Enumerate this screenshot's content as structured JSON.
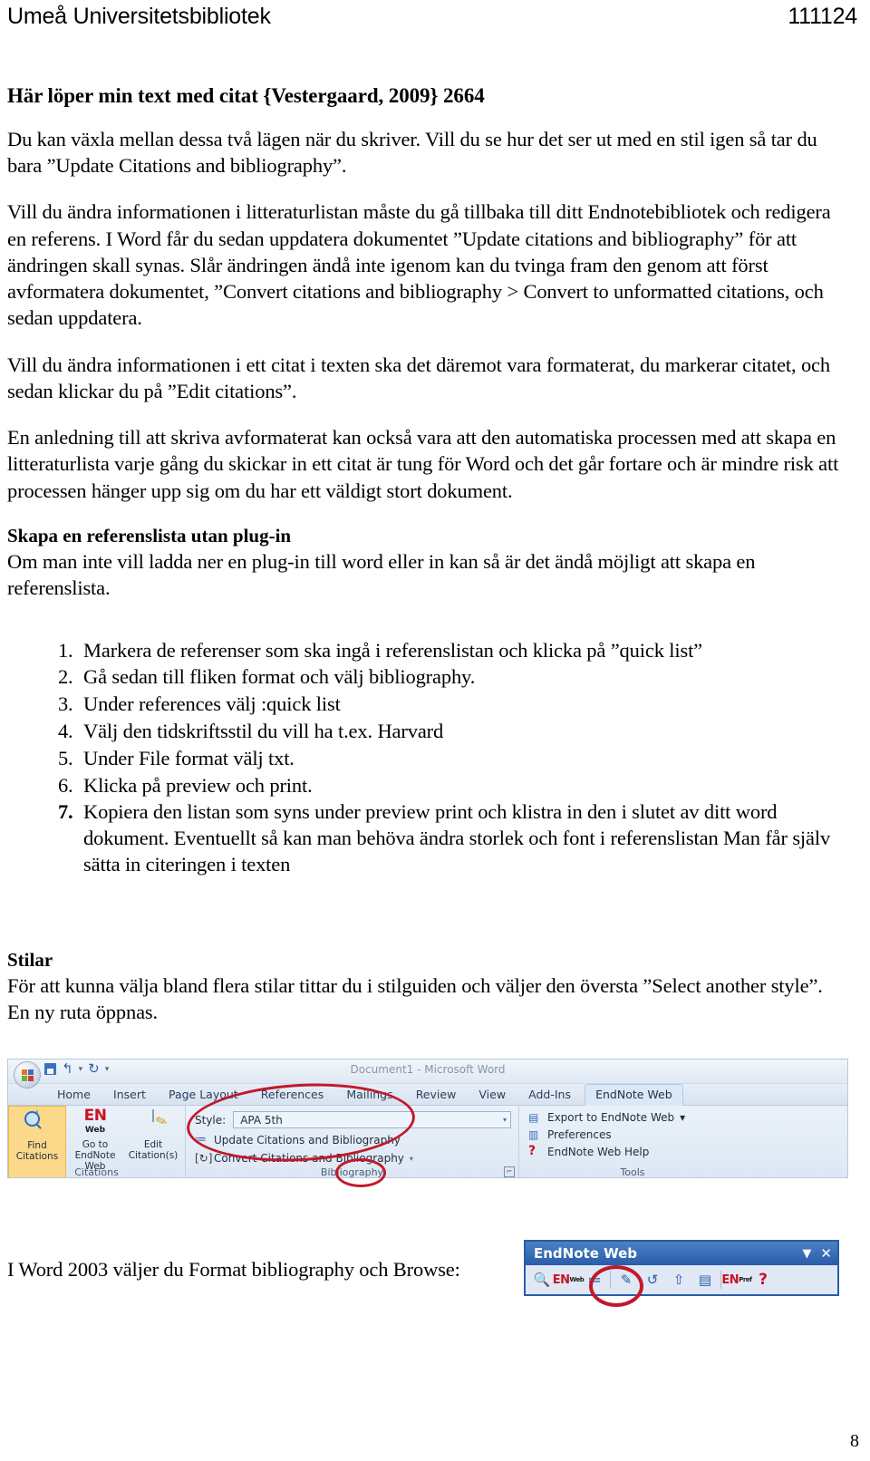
{
  "header": {
    "organization": "Umeå Universitetsbibliotek",
    "document_number": "111124"
  },
  "title": "Här löper min text med citat {Vestergaard, 2009} 2664",
  "paragraphs": {
    "p1": "Du kan växla mellan dessa två lägen när du skriver. Vill du se hur det ser ut med en stil igen så tar du bara ”Update Citations and bibliography”.",
    "p2": "Vill du ändra informationen i litteraturlistan måste du gå tillbaka till ditt Endnotebibliotek och redigera en referens. I Word får du sedan uppdatera dokumentet ”Update citations and bibliography” för att ändringen skall synas. Slår ändringen ändå inte igenom kan du tvinga fram den genom att först avformatera dokumentet, ”Convert citations and bibliography > Convert to unformatted citations, och sedan uppdatera.",
    "p3": "Vill du ändra informationen i ett citat i texten ska det däremot vara formaterat, du markerar citatet, och sedan klickar du på ”Edit citations”.",
    "p4": "En anledning till att skriva avformaterat kan också vara att den automatiska processen med att skapa en litteraturlista varje gång du skickar in ett citat är tung för Word och det går fortare och är mindre risk att processen hänger upp sig om du har ett väldigt stort dokument."
  },
  "section_plugin": {
    "heading": "Skapa en referenslista utan plug-in",
    "intro": "Om man inte vill ladda ner en plug-in till word eller in kan så är det ändå möjligt att skapa en referenslista.",
    "steps": [
      "Markera de referenser som ska ingå i referenslistan och klicka på ”quick list”",
      "Gå sedan till fliken format och välj bibliography.",
      "Under references välj :quick list",
      "Välj den tidskriftsstil du vill ha t.ex. Harvard",
      "Under File format välj txt.",
      "Klicka på preview och print.",
      "Kopiera den listan som syns under preview print och klistra in den i slutet av ditt word dokument. Eventuellt så kan man behöva ändra storlek och font i referenslistan Man får själv sätta in citeringen i texten"
    ]
  },
  "section_stilar": {
    "heading": "Stilar",
    "text": "För att kunna välja bland flera stilar tittar du i stilguiden och väljer den översta ”Select another style”. En ny ruta öppnas."
  },
  "word_ribbon": {
    "window_title": "Document1 - Microsoft Word",
    "quick_access": {
      "save_icon": "save-icon",
      "undo_icon": "undo-icon",
      "redo_icon": "redo-icon",
      "customize_icon": "chevron-down-icon"
    },
    "tabs": [
      "Home",
      "Insert",
      "Page Layout",
      "References",
      "Mailings",
      "Review",
      "View",
      "Add-Ins",
      "EndNote Web"
    ],
    "active_tab": "EndNote Web",
    "groups": {
      "citations": {
        "label": "Citations",
        "buttons": [
          {
            "line1": "Find",
            "line2": "Citations",
            "icon": "find-citations-icon",
            "selected": true
          },
          {
            "line1": "Go to",
            "line2": "EndNote Web",
            "icon": "endnote-web-icon",
            "selected": false
          },
          {
            "line1": "Edit",
            "line2": "Citation(s)",
            "icon": "edit-citation-icon",
            "selected": false
          }
        ]
      },
      "bibliography": {
        "label": "Bibliography",
        "style_label": "Style:",
        "style_value": "APA 5th",
        "commands": [
          {
            "label": "Update Citations and Bibliography",
            "icon": "update-citations-icon",
            "has_dropdown": false
          },
          {
            "label": "Convert Citations and Bibliography",
            "icon": "convert-citations-icon",
            "has_dropdown": true
          }
        ],
        "dialog_launcher_icon": "dialog-launcher-icon"
      },
      "tools": {
        "label": "Tools",
        "commands": [
          {
            "label": "Export to EndNote Web",
            "icon": "export-icon",
            "has_dropdown": true
          },
          {
            "label": "Preferences",
            "icon": "preferences-icon",
            "has_dropdown": false
          },
          {
            "label": "EndNote Web Help",
            "icon": "help-icon",
            "has_dropdown": false
          }
        ]
      }
    },
    "annotation_color": "#c2182b"
  },
  "word2003_line": "I Word 2003 väljer du Format bibliography och Browse:",
  "endnote_toolbar": {
    "title": "EndNote Web",
    "minimize_icon": "chevron-down-icon",
    "close_icon": "close-icon",
    "icons": [
      "find-citations-icon",
      "endnote-web-icon",
      "format-bibliography-icon",
      "edit-citation-icon",
      "unformat-citations-icon",
      "export-travelling-library-icon",
      "import-references-icon",
      "endnote-web-preferences-icon",
      "endnote-web-help-icon"
    ]
  },
  "page_number": "8"
}
